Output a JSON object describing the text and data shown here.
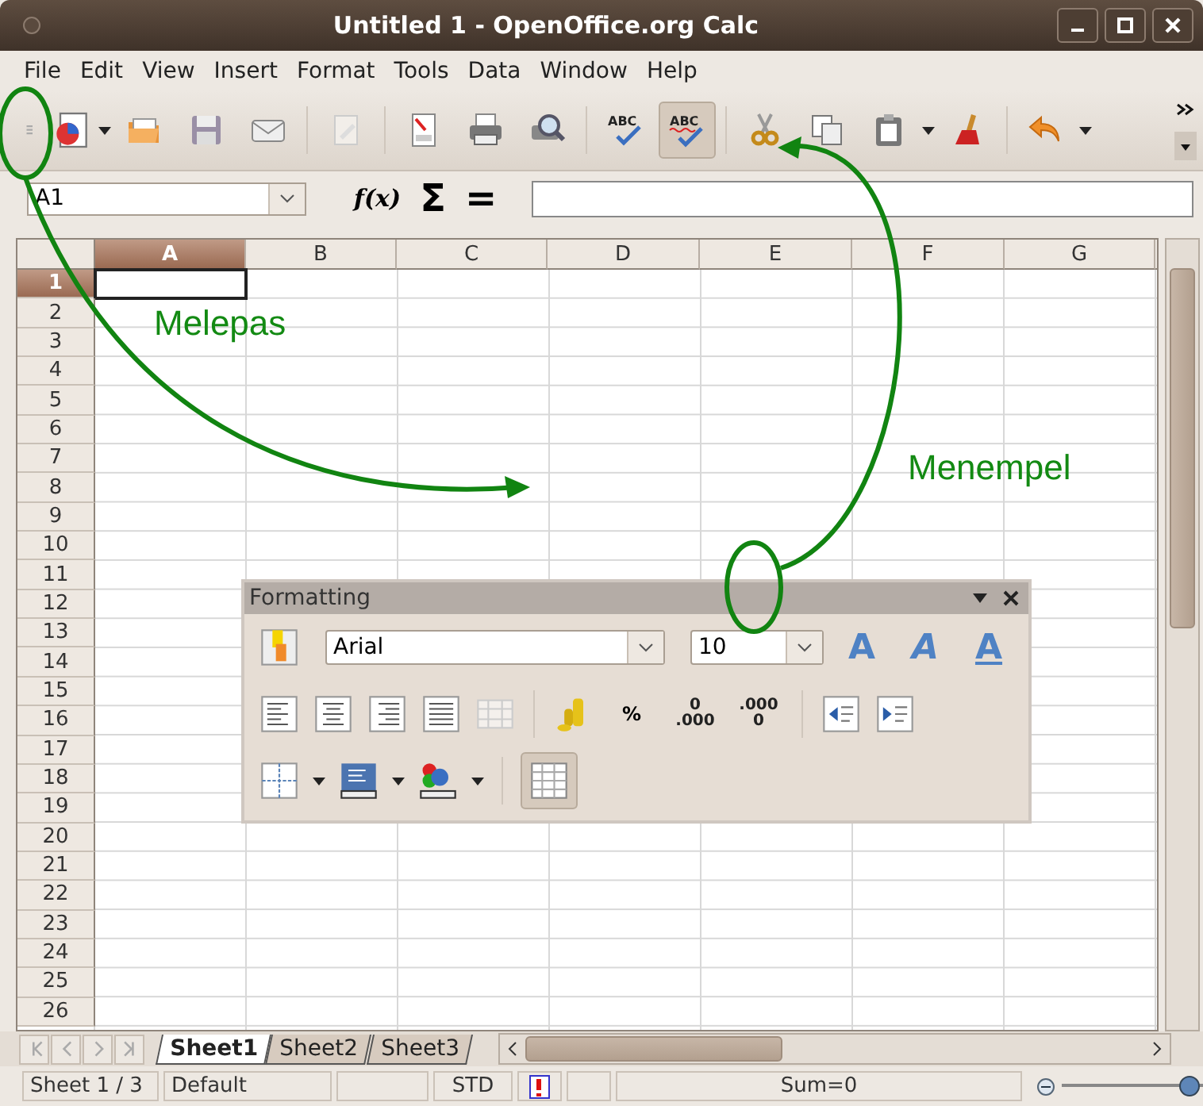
{
  "window": {
    "title": "Untitled 1 - OpenOffice.org Calc"
  },
  "menu": [
    "File",
    "Edit",
    "View",
    "Insert",
    "Format",
    "Tools",
    "Data",
    "Window",
    "Help"
  ],
  "standard_toolbar": {
    "spellcheck_text": "ABC",
    "auto_spellcheck_text": "ABC",
    "auto_spellcheck_on": true
  },
  "formula_bar": {
    "name_box": "A1",
    "function_wizard": "f(x)",
    "sum": "Σ",
    "equals": "="
  },
  "columns": [
    {
      "label": "A",
      "selected": true
    },
    {
      "label": "B",
      "selected": false
    },
    {
      "label": "C",
      "selected": false
    },
    {
      "label": "D",
      "selected": false
    },
    {
      "label": "E",
      "selected": false
    },
    {
      "label": "F",
      "selected": false
    },
    {
      "label": "G",
      "selected": false
    }
  ],
  "rows": [
    {
      "label": "1",
      "selected": true
    },
    {
      "label": "2",
      "selected": false
    },
    {
      "label": "3",
      "selected": false
    },
    {
      "label": "4",
      "selected": false
    },
    {
      "label": "5",
      "selected": false
    },
    {
      "label": "6",
      "selected": false
    },
    {
      "label": "7",
      "selected": false
    },
    {
      "label": "8",
      "selected": false
    },
    {
      "label": "9",
      "selected": false
    },
    {
      "label": "10",
      "selected": false
    },
    {
      "label": "11",
      "selected": false
    },
    {
      "label": "12",
      "selected": false
    },
    {
      "label": "13",
      "selected": false
    },
    {
      "label": "14",
      "selected": false
    },
    {
      "label": "15",
      "selected": false
    },
    {
      "label": "16",
      "selected": false
    },
    {
      "label": "17",
      "selected": false
    },
    {
      "label": "18",
      "selected": false
    },
    {
      "label": "19",
      "selected": false
    },
    {
      "label": "20",
      "selected": false
    },
    {
      "label": "21",
      "selected": false
    },
    {
      "label": "22",
      "selected": false
    },
    {
      "label": "23",
      "selected": false
    },
    {
      "label": "24",
      "selected": false
    },
    {
      "label": "25",
      "selected": false
    },
    {
      "label": "26",
      "selected": false
    }
  ],
  "sheet_tabs": [
    {
      "label": "Sheet1",
      "selected": true
    },
    {
      "label": "Sheet2",
      "selected": false
    },
    {
      "label": "Sheet3",
      "selected": false
    }
  ],
  "status_bar": {
    "sheet": "Sheet 1 / 3",
    "page_style": "Default",
    "selection_mode": "STD",
    "sum": "Sum=0",
    "zoom": {
      "level": 0.9
    }
  },
  "formatting_toolbar": {
    "title": "Formatting",
    "font_name": "Arial",
    "font_size": "10",
    "style_buttons": [
      {
        "kind": "bold",
        "glyph": "A"
      },
      {
        "kind": "italic",
        "glyph": "A"
      },
      {
        "kind": "underline",
        "glyph": "A"
      }
    ],
    "percent": "%",
    "add_decimal": [
      "0",
      ".000"
    ],
    "delete_decimal": [
      ".000",
      "0"
    ],
    "show_grid_on": true
  },
  "annotations": [
    {
      "kind": "detach",
      "text": "Melepas"
    },
    {
      "kind": "attach",
      "text": "Menempel"
    }
  ]
}
